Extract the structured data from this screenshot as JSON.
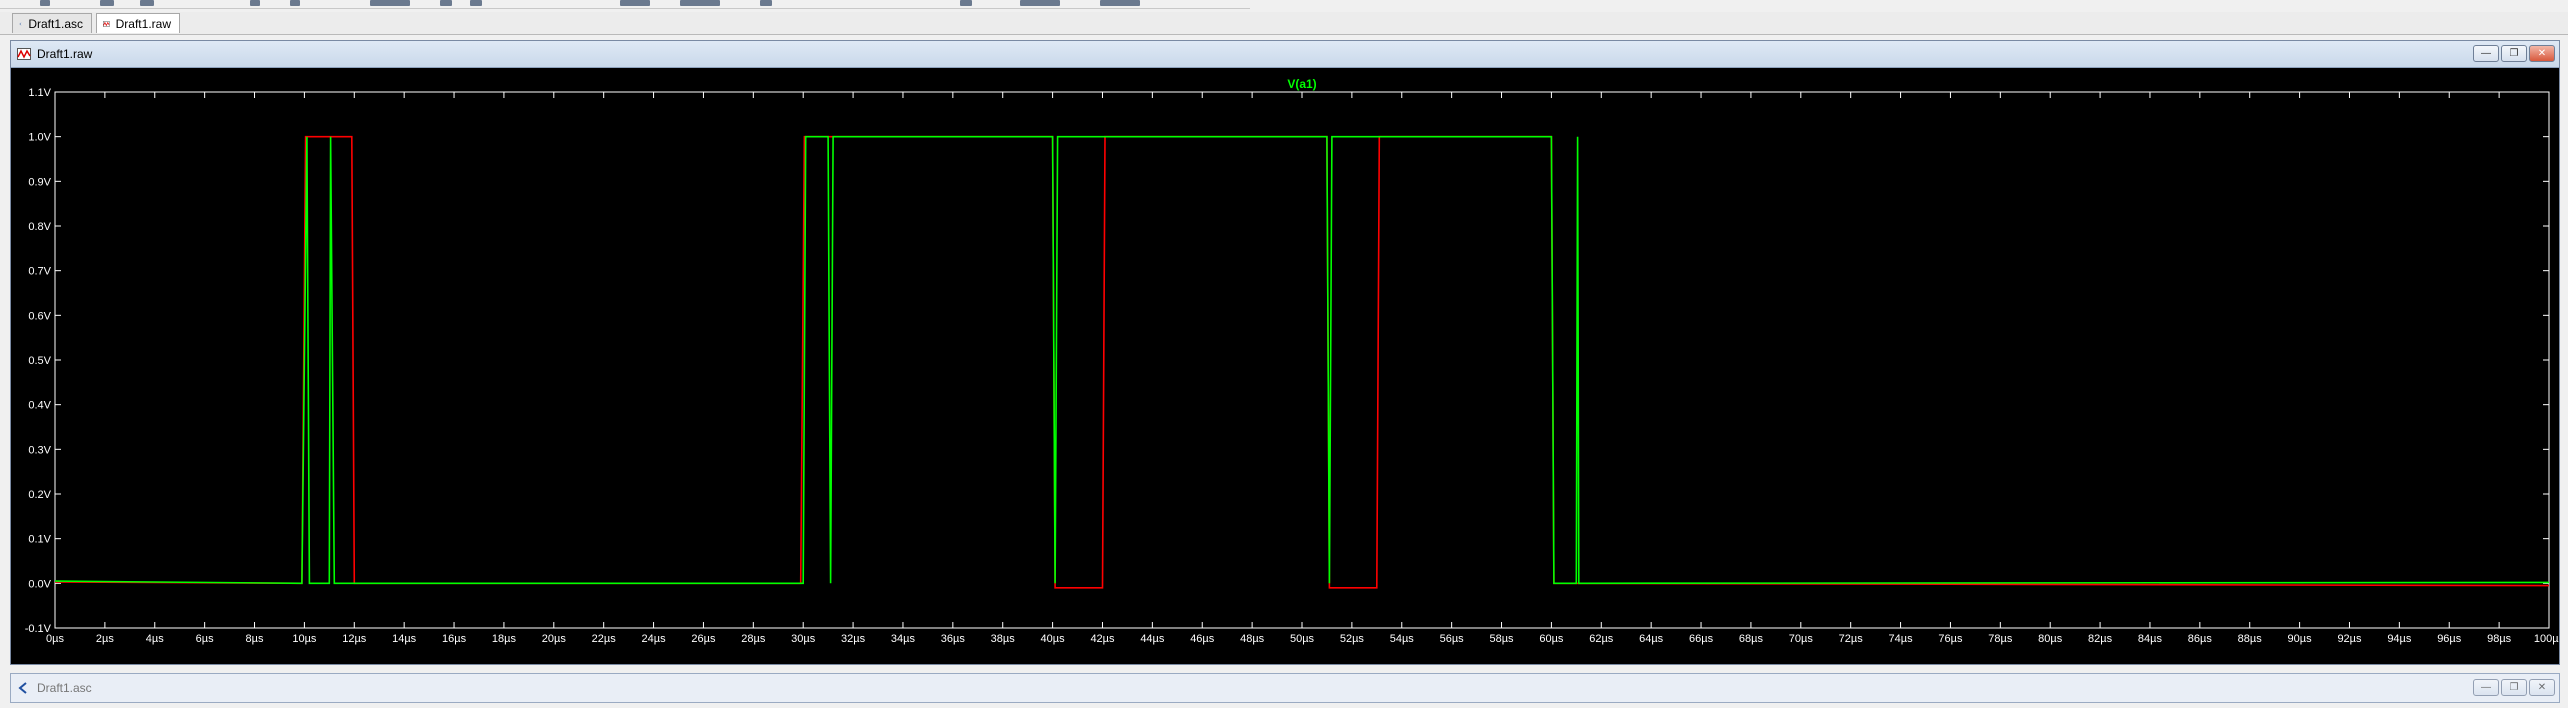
{
  "tabs": [
    {
      "label": "Draft1.asc",
      "icon": "schematic-icon",
      "active": false
    },
    {
      "label": "Draft1.raw",
      "icon": "waveform-icon",
      "active": true
    }
  ],
  "plot_window": {
    "title": "Draft1.raw",
    "icon": "waveform-icon"
  },
  "bottom_window": {
    "title": "Draft1.asc",
    "icon": "schematic-icon"
  },
  "window_buttons": {
    "minimize": "—",
    "restore": "❐",
    "close": "✕"
  },
  "chart_data": {
    "type": "line",
    "title": "",
    "xlabel": "",
    "ylabel": "",
    "xlim": [
      0,
      100
    ],
    "ylim": [
      -0.1,
      1.1
    ],
    "grid": false,
    "background": "#000000",
    "axis_color": "#ffffff",
    "x_ticks": [
      "0µs",
      "2µs",
      "4µs",
      "6µs",
      "8µs",
      "10µs",
      "12µs",
      "14µs",
      "16µs",
      "18µs",
      "20µs",
      "22µs",
      "24µs",
      "26µs",
      "28µs",
      "30µs",
      "32µs",
      "34µs",
      "36µs",
      "38µs",
      "40µs",
      "42µs",
      "44µs",
      "46µs",
      "48µs",
      "50µs",
      "52µs",
      "54µs",
      "56µs",
      "58µs",
      "60µs",
      "62µs",
      "64µs",
      "66µs",
      "68µs",
      "70µs",
      "72µs",
      "74µs",
      "76µs",
      "78µs",
      "80µs",
      "82µs",
      "84µs",
      "86µs",
      "88µs",
      "90µs",
      "92µs",
      "94µs",
      "96µs",
      "98µs",
      "100µs"
    ],
    "y_ticks": [
      "-0.1V",
      "0.0V",
      "0.1V",
      "0.2V",
      "0.3V",
      "0.4V",
      "0.5V",
      "0.6V",
      "0.7V",
      "0.8V",
      "0.9V",
      "1.0V",
      "1.1V"
    ],
    "series": [
      {
        "name": "V(a1)",
        "color": "#00ff00",
        "x": [
          0,
          9.9,
          10.1,
          10.2,
          11.0,
          11.05,
          11.2,
          12.0,
          12.1,
          30.0,
          30.1,
          31.0,
          31.1,
          31.2,
          40.0,
          40.1,
          40.2,
          40.3,
          51.0,
          51.1,
          51.2,
          51.3,
          60.0,
          60.1,
          61.0,
          61.05,
          61.1,
          61.2,
          100
        ],
        "y": [
          0.005,
          0.0,
          1.0,
          0.0,
          0.0,
          1.0,
          0.0,
          0.0,
          0.0,
          0.0,
          1.0,
          1.0,
          0.0,
          1.0,
          1.0,
          0.0,
          1.0,
          1.0,
          1.0,
          0.0,
          1.0,
          1.0,
          1.0,
          0.0,
          0.0,
          1.0,
          0.0,
          0.0,
          0.002
        ]
      },
      {
        "color": "#ff0000",
        "x": [
          0,
          9.9,
          10.05,
          11.9,
          12.0,
          29.9,
          30.05,
          40.0,
          40.1,
          42.0,
          42.1,
          51.0,
          51.1,
          53.0,
          53.1,
          60.0,
          60.1,
          100
        ],
        "y": [
          0.003,
          0.0,
          1.0,
          1.0,
          0.0,
          0.0,
          1.0,
          1.0,
          -0.01,
          -0.01,
          1.0,
          1.0,
          -0.01,
          -0.01,
          1.0,
          1.0,
          0.0,
          -0.005
        ]
      }
    ]
  }
}
